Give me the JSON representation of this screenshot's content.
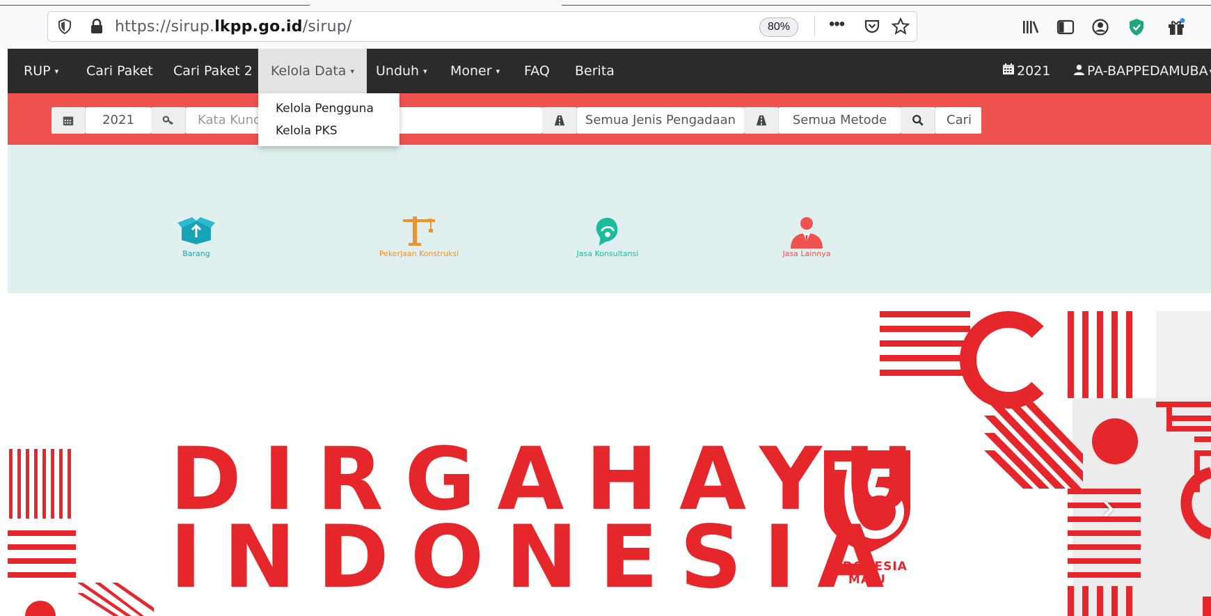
{
  "browser": {
    "url_prefix": "https://sirup.",
    "url_domain": "lkpp.go.id",
    "url_path": "/sirup/",
    "zoom": "80%",
    "page_actions_label": "•••"
  },
  "nav": {
    "items": [
      {
        "label": "RUP"
      },
      {
        "label": "Cari Paket"
      },
      {
        "label": "Cari Paket 2"
      },
      {
        "label": "Kelola Data"
      },
      {
        "label": "Unduh"
      },
      {
        "label": "Moner"
      },
      {
        "label": "FAQ"
      },
      {
        "label": "Berita"
      }
    ],
    "year": "2021",
    "user": "PA-BAPPEDAMUBA"
  },
  "dropdown": {
    "items": [
      {
        "label": "Kelola Pengguna"
      },
      {
        "label": "Kelola PKS"
      }
    ]
  },
  "search": {
    "year_value": "2021",
    "keyword_placeholder": "Kata Kunci",
    "jenis_value": "Semua Jenis Pengadaan",
    "metode_value": "Semua Metode",
    "button_label": "Cari"
  },
  "categories": [
    {
      "label": "Barang",
      "color": "#17a2b8"
    },
    {
      "label": "Pekerjaan Konstruksi",
      "color": "#f0922b"
    },
    {
      "label": "Jasa Konsultansi",
      "color": "#1abc9c"
    },
    {
      "label": "Jasa Lainnya",
      "color": "#ef5350"
    }
  ],
  "banner": {
    "line1": "DIRGAHAYU",
    "line2": "INDONESIA",
    "badge_line1": "INDONESIA",
    "badge_line2": "MAJU",
    "next_arrow": "›",
    "accent": "#e5262a"
  },
  "colors": {
    "navbar": "#2b2b2b",
    "searchbar": "#ef5350",
    "category_band": "#dff0ee"
  }
}
